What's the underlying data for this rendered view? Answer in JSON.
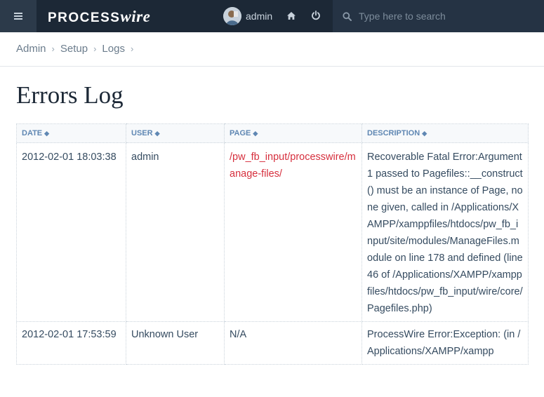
{
  "header": {
    "logo_main": "PROCESS",
    "logo_accent": "wire",
    "user_name": "admin",
    "search_placeholder": "Type here to search"
  },
  "breadcrumb": [
    "Admin",
    "Setup",
    "Logs"
  ],
  "page_title": "Errors Log",
  "table": {
    "columns": [
      "DATE",
      "USER",
      "PAGE",
      "DESCRIPTION"
    ],
    "rows": [
      {
        "date": "2012-02-01 18:03:38",
        "user": "admin",
        "page": "/pw_fb_input/processwire/manage-files/",
        "description": "Recoverable Fatal Error:Argument 1 passed to Pagefiles::__construct() must be an instance of Page, none given, called in /Applications/XAMPP/xamppfiles/htdocs/pw_fb_input/site/modules/ManageFiles.module on line 178 and defined (line 46 of /Applications/XAMPP/xamppfiles/htdocs/pw_fb_input/wire/core/Pagefiles.php)"
      },
      {
        "date": "2012-02-01 17:53:59",
        "user": "Unknown User",
        "page": "N/A",
        "description": "ProcessWire Error:Exception: (in /Applications/XAMPP/xampp"
      }
    ]
  },
  "icons": {
    "menu": "menu-icon",
    "home": "home-icon",
    "logout": "power-icon",
    "search": "search-icon",
    "sort": "sort-icon"
  },
  "colors": {
    "topbar": "#1c2836",
    "link_red": "#d62f3d",
    "header_blue": "#5f87b3"
  }
}
